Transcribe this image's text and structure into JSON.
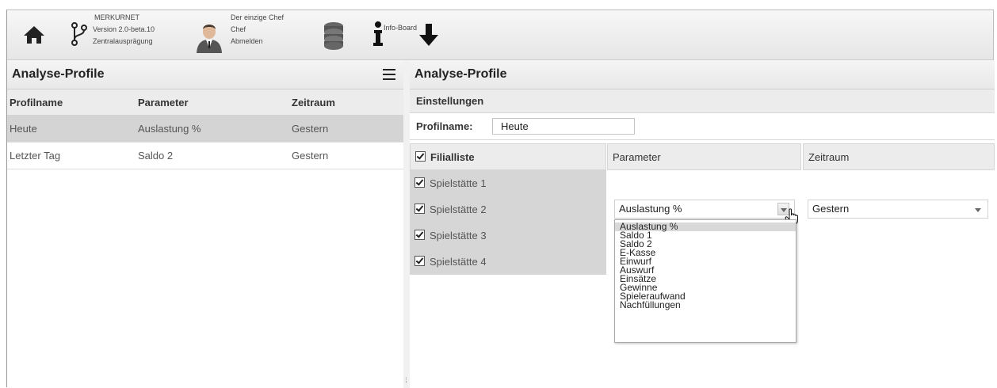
{
  "toolbar": {
    "app_name": "MERKURNET",
    "version": "Version 2.0-beta.10",
    "edition": "Zentralausprägung",
    "user_name": "Der einzige Chef",
    "user_role": "Chef",
    "logout": "Abmelden",
    "infoboard": "Info-Board"
  },
  "left_panel": {
    "title": "Analyse-Profile",
    "columns": [
      "Profilname",
      "Parameter",
      "Zeitraum"
    ],
    "rows": [
      {
        "name": "Heute",
        "parameter": "Auslastung %",
        "period": "Gestern",
        "selected": true
      },
      {
        "name": "Letzter Tag",
        "parameter": "Saldo 2",
        "period": "Gestern",
        "selected": false
      }
    ]
  },
  "right_panel": {
    "title": "Analyse-Profile",
    "settings_title": "Einstellungen",
    "profile_name_label": "Profilname:",
    "profile_name_value": "Heute",
    "branch_list": {
      "header": "Filialliste",
      "items": [
        "Spielstätte 1",
        "Spielstätte 2",
        "Spielstätte 3",
        "Spielstätte 4"
      ]
    },
    "parameter": {
      "header": "Parameter",
      "selected": "Auslastung %",
      "options": [
        "Auslastung %",
        "Saldo 1",
        "Saldo 2",
        "E-Kasse",
        "Einwurf",
        "Auswurf",
        "Einsätze",
        "Gewinne",
        "Spieleraufwand",
        "Nachfüllungen"
      ]
    },
    "period": {
      "header": "Zeitraum",
      "selected": "Gestern"
    }
  }
}
